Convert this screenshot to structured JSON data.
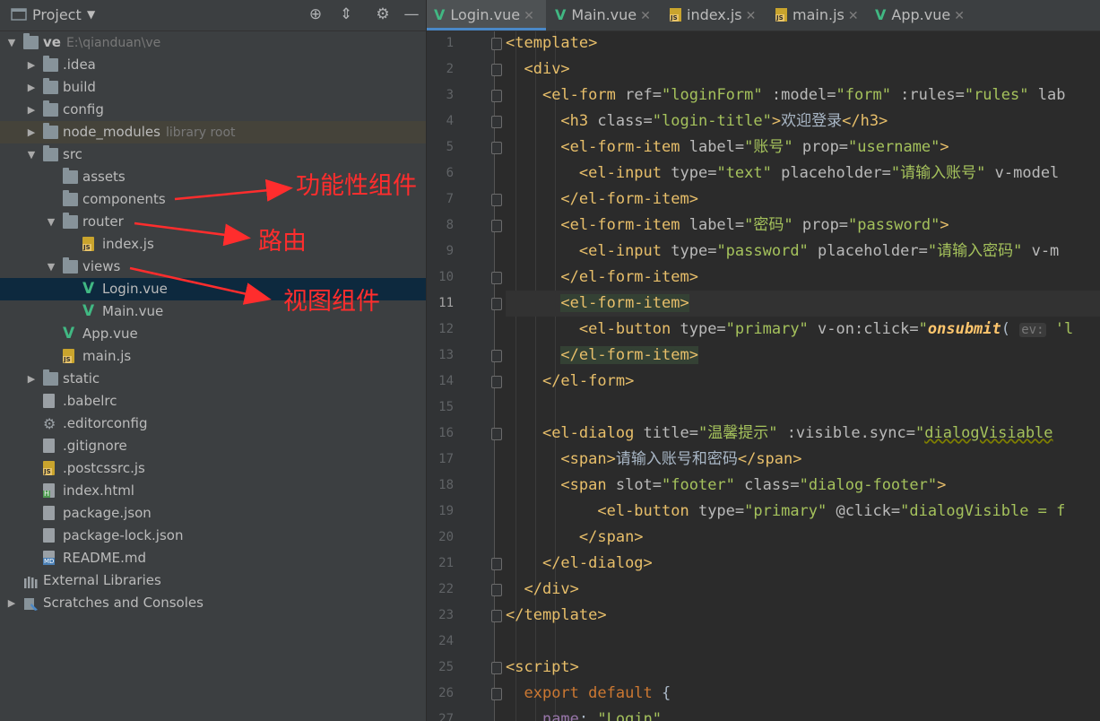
{
  "project_panel": {
    "title": "Project",
    "tree": [
      {
        "label": "ve",
        "hint": "E:\\qianduan\\ve",
        "type": "project",
        "depth": 0,
        "expanded": true
      },
      {
        "label": ".idea",
        "type": "folder",
        "depth": 1,
        "expanded": false
      },
      {
        "label": "build",
        "type": "folder",
        "depth": 1,
        "expanded": false
      },
      {
        "label": "config",
        "type": "folder",
        "depth": 1,
        "expanded": false
      },
      {
        "label": "node_modules",
        "hint": "library root",
        "type": "folder",
        "depth": 1,
        "expanded": false,
        "highlight": true
      },
      {
        "label": "src",
        "type": "folder",
        "depth": 1,
        "expanded": true
      },
      {
        "label": "assets",
        "type": "folder",
        "depth": 2
      },
      {
        "label": "components",
        "type": "folder",
        "depth": 2
      },
      {
        "label": "router",
        "type": "folder",
        "depth": 2,
        "expanded": true
      },
      {
        "label": "index.js",
        "type": "js",
        "depth": 3
      },
      {
        "label": "views",
        "type": "folder",
        "depth": 2,
        "expanded": true
      },
      {
        "label": "Login.vue",
        "type": "vue",
        "depth": 3,
        "selected": true
      },
      {
        "label": "Main.vue",
        "type": "vue",
        "depth": 3
      },
      {
        "label": "App.vue",
        "type": "vue",
        "depth": 2
      },
      {
        "label": "main.js",
        "type": "js",
        "depth": 2
      },
      {
        "label": "static",
        "type": "folder",
        "depth": 1,
        "expanded": false
      },
      {
        "label": ".babelrc",
        "type": "config",
        "depth": 1
      },
      {
        "label": ".editorconfig",
        "type": "gear",
        "depth": 1
      },
      {
        "label": ".gitignore",
        "type": "config",
        "depth": 1
      },
      {
        "label": ".postcssrc.js",
        "type": "js",
        "depth": 1
      },
      {
        "label": "index.html",
        "type": "html",
        "depth": 1
      },
      {
        "label": "package.json",
        "type": "config",
        "depth": 1
      },
      {
        "label": "package-lock.json",
        "type": "config",
        "depth": 1
      },
      {
        "label": "README.md",
        "type": "md",
        "depth": 1
      },
      {
        "label": "External Libraries",
        "type": "libs",
        "depth": 0
      },
      {
        "label": "Scratches and Consoles",
        "type": "scratch",
        "depth": 0,
        "expanded": false
      }
    ]
  },
  "tabs": [
    {
      "label": "Login.vue",
      "type": "vue",
      "active": true
    },
    {
      "label": "Main.vue",
      "type": "vue"
    },
    {
      "label": "index.js",
      "type": "js"
    },
    {
      "label": "main.js",
      "type": "js"
    },
    {
      "label": "App.vue",
      "type": "vue"
    }
  ],
  "editor": {
    "current_line": 11,
    "lines": [
      [
        [
          "tag",
          "<template>"
        ]
      ],
      [
        [
          "t",
          "  "
        ],
        [
          "tag",
          "<div>"
        ]
      ],
      [
        [
          "t",
          "    "
        ],
        [
          "tag",
          "<el-form "
        ],
        [
          "attr",
          "ref="
        ],
        [
          "str",
          "\"loginForm\""
        ],
        [
          "attr",
          " :model="
        ],
        [
          "str",
          "\"form\""
        ],
        [
          "attr",
          " :rules="
        ],
        [
          "str",
          "\"rules\""
        ],
        [
          "attr",
          " lab"
        ]
      ],
      [
        [
          "t",
          "      "
        ],
        [
          "tag",
          "<h3 "
        ],
        [
          "attr",
          "class="
        ],
        [
          "str",
          "\"login-title\""
        ],
        [
          "tag",
          ">"
        ],
        [
          "txt",
          "欢迎登录"
        ],
        [
          "tag",
          "</h3>"
        ]
      ],
      [
        [
          "t",
          "      "
        ],
        [
          "tag",
          "<el-form-item "
        ],
        [
          "attr",
          "label="
        ],
        [
          "str",
          "\"账号\""
        ],
        [
          "attr",
          " prop="
        ],
        [
          "str",
          "\"username\""
        ],
        [
          "tag",
          ">"
        ]
      ],
      [
        [
          "t",
          "        "
        ],
        [
          "tag",
          "<el-input "
        ],
        [
          "attr",
          "type="
        ],
        [
          "str",
          "\"text\""
        ],
        [
          "attr",
          " placeholder="
        ],
        [
          "str",
          "\"请输入账号\""
        ],
        [
          "attr",
          " v-model"
        ]
      ],
      [
        [
          "t",
          "      "
        ],
        [
          "tag",
          "</el-form-item>"
        ]
      ],
      [
        [
          "t",
          "      "
        ],
        [
          "tag",
          "<el-form-item "
        ],
        [
          "attr",
          "label="
        ],
        [
          "str",
          "\"密码\""
        ],
        [
          "attr",
          " prop="
        ],
        [
          "str",
          "\"password\""
        ],
        [
          "tag",
          ">"
        ]
      ],
      [
        [
          "t",
          "        "
        ],
        [
          "tag",
          "<el-input "
        ],
        [
          "attr",
          "type="
        ],
        [
          "str",
          "\"password\""
        ],
        [
          "attr",
          " placeholder="
        ],
        [
          "str",
          "\"请输入密码\""
        ],
        [
          "attr",
          " v-m"
        ]
      ],
      [
        [
          "t",
          "      "
        ],
        [
          "tag",
          "</el-form-item>"
        ]
      ],
      [
        [
          "t",
          "      "
        ],
        [
          "tagh",
          "<el-form-item>"
        ]
      ],
      [
        [
          "t",
          "        "
        ],
        [
          "tag",
          "<el-button "
        ],
        [
          "attr",
          "type="
        ],
        [
          "str",
          "\"primary\""
        ],
        [
          "attr",
          " v-on:click="
        ],
        [
          "str",
          "\""
        ],
        [
          "fn",
          "onsubmit"
        ],
        [
          "txt",
          "( "
        ],
        [
          "hint",
          "ev:"
        ],
        [
          "str",
          " 'l"
        ]
      ],
      [
        [
          "t",
          "      "
        ],
        [
          "tagh",
          "</el-form-item>"
        ]
      ],
      [
        [
          "t",
          "    "
        ],
        [
          "tag",
          "</el-form>"
        ]
      ],
      [],
      [
        [
          "t",
          "    "
        ],
        [
          "tag",
          "<el-dialog "
        ],
        [
          "attr",
          "title="
        ],
        [
          "str",
          "\"温馨提示\""
        ],
        [
          "attr",
          " :visible.sync="
        ],
        [
          "str",
          "\""
        ],
        [
          "wavy",
          "dialogVisiable"
        ]
      ],
      [
        [
          "t",
          "      "
        ],
        [
          "tag",
          "<span>"
        ],
        [
          "txt",
          "请输入账号和密码"
        ],
        [
          "tag",
          "</span>"
        ]
      ],
      [
        [
          "t",
          "      "
        ],
        [
          "tag",
          "<span "
        ],
        [
          "attr",
          "slot="
        ],
        [
          "str",
          "\"footer\""
        ],
        [
          "attr",
          " class="
        ],
        [
          "str",
          "\"dialog-footer\""
        ],
        [
          "tag",
          ">"
        ]
      ],
      [
        [
          "t",
          "          "
        ],
        [
          "tag",
          "<el-button "
        ],
        [
          "attr",
          "type="
        ],
        [
          "str",
          "\"primary\""
        ],
        [
          "attr",
          " @click="
        ],
        [
          "str",
          "\"dialogVisible = f"
        ]
      ],
      [
        [
          "t",
          "        "
        ],
        [
          "tag",
          "</span>"
        ]
      ],
      [
        [
          "t",
          "    "
        ],
        [
          "tag",
          "</el-dialog>"
        ]
      ],
      [
        [
          "t",
          "  "
        ],
        [
          "tag",
          "</div>"
        ]
      ],
      [
        [
          "tag",
          "</template>"
        ]
      ],
      [],
      [
        [
          "tag",
          "<script>"
        ]
      ],
      [
        [
          "t",
          "  "
        ],
        [
          "kw",
          "export default "
        ],
        [
          "txt",
          "{"
        ]
      ],
      [
        [
          "t",
          "    "
        ],
        [
          "prop",
          "name"
        ],
        [
          "txt",
          ": "
        ],
        [
          "str",
          "\"Login\""
        ],
        [
          "txt",
          ","
        ]
      ]
    ]
  },
  "annotations": [
    {
      "text": "功能性组件",
      "color": "#ff2d2d"
    },
    {
      "text": "路由",
      "color": "#ff2d2d"
    },
    {
      "text": "视图组件",
      "color": "#ff2d2d"
    }
  ]
}
